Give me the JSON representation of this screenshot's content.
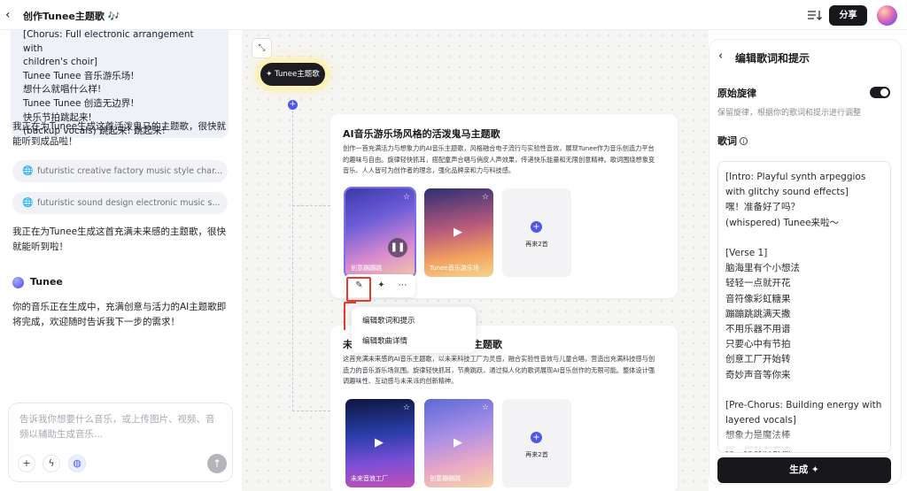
{
  "header": {
    "title": "创作Tunee主题歌 🎶",
    "share_label": "分享"
  },
  "chat": {
    "lyrics_snippet": "[Chorus: Full electronic arrangement with\nchildren's choir]\nTunee Tunee 音乐游乐场!\n想什么就唱什么样!\nTunee Tunee 创造无边界!\n快乐节拍跳起来!\n(backup vocals) 跳起来! 跳起来!",
    "message_1": "我正在为Tunee生成这首活泼鬼马的主题歌，很快就能听到成品啦！",
    "chips": [
      "futuristic creative factory music style char...",
      "futuristic sound design electronic music s..."
    ],
    "message_2": "我正在为Tunee生成这首充满未来感的主题歌，很快就能听到啦！",
    "agent_name": "Tunee",
    "agent_message": "你的音乐正在生成中，充满创意与活力的AI主题歌即将完成，欢迎随时告诉我下一步的需求！",
    "composer_placeholder": "告诉我你想要什么音乐，或上传图片、视频、音频以辅助生成音乐..."
  },
  "canvas": {
    "root_node_label": "✦ Tunee主题歌",
    "card1": {
      "title": "AI音乐游乐场风格的活泼鬼马主题歌",
      "description": "创作一首充满活力与想象力的AI音乐主题歌，风格融合电子流行与实验性音效，展现Tunee作为音乐创造力平台的趣味与自由。旋律轻快抓耳，搭配童声合唱与俏皮人声效果，传递快乐能量和无限创意精神。歌词围绕想象变音乐、人人皆可为创作者的理念，强化品牌亲和力与科技感。",
      "tiles": [
        {
          "caption": "创意蹦蹦跳"
        },
        {
          "caption": "Tunee音乐游乐场"
        }
      ],
      "more_label": "再来2首"
    },
    "card2": {
      "title": "未来感音乐工厂风格的Tunee主题歌",
      "description": "这首充满未来感的AI音乐主题歌，以未来科技工厂为灵感，融合实验性音效与儿童合唱，营造出充满科技感与创造力的音乐游乐场氛围。旋律轻快抓耳，节奏跳跃，通过拟人化的歌词展现AI音乐创作的无限可能。整体设计强调趣味性、互动感与未来派的创新精神。",
      "tiles": [
        {
          "caption": "未来音浪工厂"
        },
        {
          "caption": "创意蹦蹦跳"
        }
      ],
      "more_label": "再来2首"
    },
    "context_menu": [
      "编辑歌词和提示",
      "编辑歌曲详情"
    ]
  },
  "panel": {
    "title": "编辑歌词和提示",
    "melody_label": "原始旋律",
    "melody_enabled": true,
    "melody_hint": "保留旋律，根据你的歌词和提示进行调整",
    "lyrics_label": "歌词",
    "lyrics_text": "[Intro: Playful synth arpeggios with glitchy sound effects]\n嘿！准备好了吗？\n(whispered) Tunee来啦～\n\n[Verse 1]\n脑海里有个小想法\n轻轻一点就开花\n音符像彩虹糖果\n蹦蹦跳跳满天撒\n不用乐器不用谱\n只要心中有节拍\n创意工厂开始转\n奇妙声音等你来\n\n[Pre-Chorus: Building energy with layered vocals]\n想象力是魔法棒\n挥一挥就有奇迹",
    "generate_label": "生成 ✦"
  },
  "colors": {
    "accent": "#4e57e8",
    "dark_button": "#17171c",
    "highlight": "#e53a2d"
  }
}
